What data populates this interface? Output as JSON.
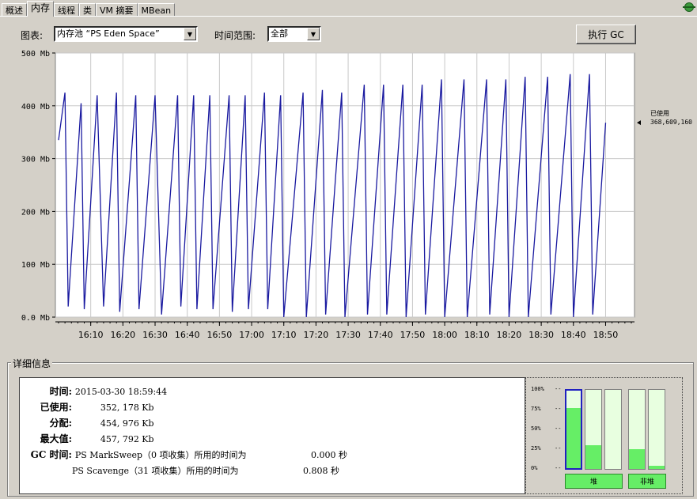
{
  "tabs": [
    "概述",
    "内存",
    "线程",
    "类",
    "VM 摘要",
    "MBean"
  ],
  "active_tab": 1,
  "toolbar": {
    "chart_label": "图表:",
    "chart_value": "内存池 “PS Eden Space”",
    "range_label": "时间范围:",
    "range_value": "全部",
    "gc_button": "执行 GC"
  },
  "chart_data": {
    "type": "line",
    "title": "",
    "xlabel": "",
    "ylabel": "",
    "ylim": [
      0,
      500
    ],
    "y_ticks": [
      "0.0 Mb",
      "100 Mb",
      "200 Mb",
      "300 Mb",
      "400 Mb",
      "500 Mb"
    ],
    "x_range": [
      "16:00",
      "18:58"
    ],
    "x_ticks": [
      "16:10",
      "16:20",
      "16:30",
      "16:40",
      "16:50",
      "17:00",
      "17:10",
      "17:20",
      "17:30",
      "17:40",
      "17:50",
      "18:00",
      "18:10",
      "18:20",
      "18:30",
      "18:40",
      "18:50"
    ],
    "series_color": "#1a1aa0",
    "annotation_label": "已使用",
    "annotation_value": "368,609,160",
    "series": [
      {
        "x": [
          "16:00",
          "16:02",
          "16:03",
          "16:07",
          "16:08",
          "16:12",
          "16:14",
          "16:18",
          "16:19",
          "16:24",
          "16:25",
          "16:30",
          "16:32",
          "16:37",
          "16:38",
          "16:42",
          "16:43",
          "16:47",
          "16:48",
          "16:53",
          "16:54",
          "16:58",
          "16:59",
          "17:04",
          "17:05",
          "17:09",
          "17:10",
          "17:16",
          "17:17",
          "17:22",
          "17:23",
          "17:28",
          "17:29",
          "17:35",
          "17:36",
          "17:41",
          "17:42",
          "17:47",
          "17:48",
          "17:53",
          "17:54",
          "17:59",
          "18:00",
          "18:06",
          "18:07",
          "18:13",
          "18:14",
          "18:19",
          "18:20",
          "18:25",
          "18:26",
          "18:32",
          "18:33",
          "18:39",
          "18:40",
          "18:45",
          "18:46",
          "18:50"
        ],
        "values": [
          335,
          425,
          20,
          405,
          15,
          420,
          20,
          425,
          10,
          420,
          15,
          420,
          5,
          420,
          20,
          420,
          15,
          420,
          15,
          420,
          10,
          420,
          15,
          425,
          15,
          420,
          0,
          425,
          0,
          430,
          5,
          425,
          0,
          440,
          5,
          440,
          5,
          440,
          0,
          440,
          5,
          450,
          0,
          450,
          0,
          450,
          5,
          450,
          0,
          455,
          0,
          455,
          5,
          460,
          0,
          460,
          5,
          368
        ]
      }
    ]
  },
  "details": {
    "title": "详细信息",
    "time_label": "时间:",
    "time_value": "2015-03-30 18:59:44",
    "used_label": "已使用:",
    "used_value": "352, 178 Kb",
    "committed_label": "分配:",
    "committed_value": "454, 976 Kb",
    "max_label": "最大值:",
    "max_value": "457, 792 Kb",
    "gc_label": "GC 时间:",
    "gc1_name": "PS MarkSweep（0 项收集）所用的时间为",
    "gc1_time": "0.000  秒",
    "gc2_name": "PS Scavenge（31 项收集）所用的时间为",
    "gc2_time": "0.808  秒"
  },
  "pools": {
    "percent_labels": [
      "100%",
      "75%",
      "50%",
      "25%",
      "0%"
    ],
    "heap": [
      0.78,
      0.3,
      0.0
    ],
    "nonheap": [
      0.25,
      0.04
    ],
    "heap_label": "堆",
    "nonheap_label": "非堆",
    "fill_color": "#66ee66"
  }
}
